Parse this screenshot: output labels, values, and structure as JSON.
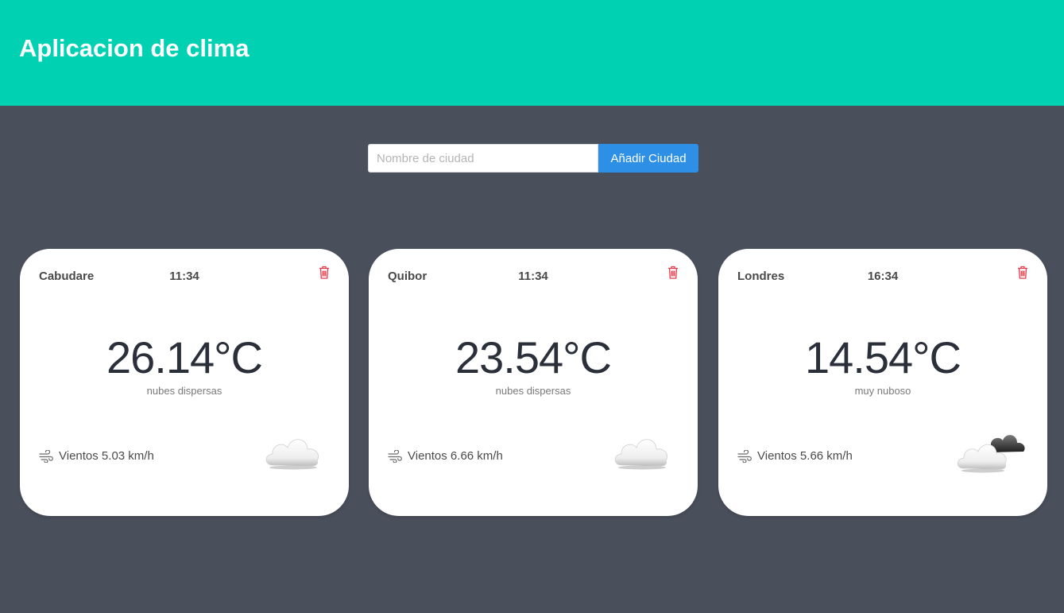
{
  "header": {
    "title": "Aplicacion de clima"
  },
  "search": {
    "placeholder": "Nombre de ciudad",
    "value": "",
    "button_label": "Añadir Ciudad"
  },
  "colors": {
    "header_bg": "#00d1b2",
    "page_bg": "#4a4f5c",
    "button_bg": "#2d8fe6",
    "delete_icon": "#e03c4a"
  },
  "cards": [
    {
      "city": "Cabudare",
      "time": "11:34",
      "temperature": "26.14°C",
      "description": "nubes dispersas",
      "wind": "Vientos 5.03 km/h",
      "icon": "cloud-icon"
    },
    {
      "city": "Quibor",
      "time": "11:34",
      "temperature": "23.54°C",
      "description": "nubes dispersas",
      "wind": "Vientos 6.66 km/h",
      "icon": "cloud-icon"
    },
    {
      "city": "Londres",
      "time": "16:34",
      "temperature": "14.54°C",
      "description": "muy nuboso",
      "wind": "Vientos 5.66 km/h",
      "icon": "overcast-clouds-icon"
    }
  ]
}
